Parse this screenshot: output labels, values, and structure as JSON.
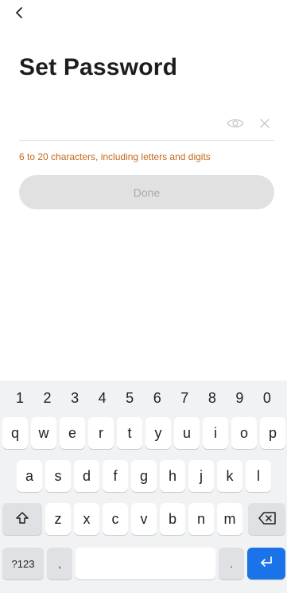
{
  "header": {
    "back_icon": "chevron-left-icon"
  },
  "page": {
    "title": "Set Password"
  },
  "password": {
    "value": "",
    "placeholder": "",
    "show_icon": "eye-icon",
    "clear_icon": "close-icon"
  },
  "hint": "6 to 20 characters, including letters and digits",
  "done_label": "Done",
  "colors": {
    "hint": "#c46a1c",
    "done_bg": "#e1e1e1",
    "done_text": "#a9a9a9",
    "keyboard_bg": "#f1f2f4",
    "enter_key": "#1a73e8"
  },
  "keyboard": {
    "numbers": [
      "1",
      "2",
      "3",
      "4",
      "5",
      "6",
      "7",
      "8",
      "9",
      "0"
    ],
    "row1": [
      "q",
      "w",
      "e",
      "r",
      "t",
      "y",
      "u",
      "i",
      "o",
      "p"
    ],
    "row2": [
      "a",
      "s",
      "d",
      "f",
      "g",
      "h",
      "j",
      "k",
      "l"
    ],
    "row3": [
      "z",
      "x",
      "c",
      "v",
      "b",
      "n",
      "m"
    ],
    "symbols_label": "?123",
    "comma": ",",
    "period": ".",
    "shift_icon": "shift-icon",
    "backspace_icon": "backspace-icon",
    "enter_icon": "enter-icon"
  }
}
